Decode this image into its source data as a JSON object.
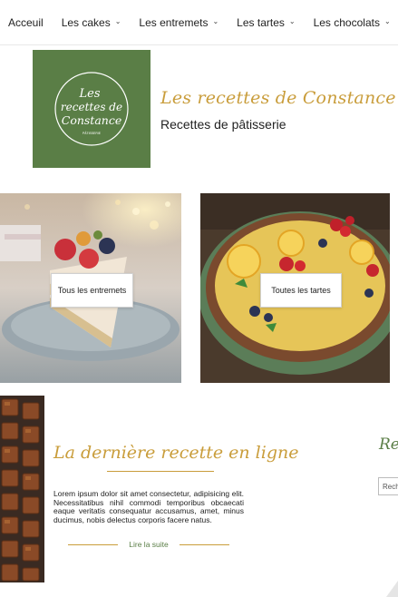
{
  "nav": {
    "items": [
      {
        "label": "Acceuil",
        "has_dropdown": false
      },
      {
        "label": "Les cakes",
        "has_dropdown": true
      },
      {
        "label": "Les entremets",
        "has_dropdown": true
      },
      {
        "label": "Les tartes",
        "has_dropdown": true
      },
      {
        "label": "Les chocolats",
        "has_dropdown": true
      }
    ],
    "dropdown_icon": "chevron-down-icon"
  },
  "header": {
    "logo": {
      "lines": [
        "Les",
        "recettes de",
        "Constance"
      ],
      "tagline": "PÂTISSERIE",
      "background": "#5a7e46"
    },
    "title": "Les recettes de Constance",
    "subtitle": "Recettes de pâtisserie"
  },
  "promos": {
    "entremets_button": "Tous les entremets",
    "tartes_button": "Toutes les tartes"
  },
  "latest": {
    "title": "La dernière recette en ligne",
    "body": "Lorem ipsum dolor sit amet consectetur, adipisicing elit. Necessitatibus nihil commodi temporibus obcaecati eaque veritatis consequatur accusamus, amet, minus ducimus, nobis delectus corporis facere natus.",
    "read_more": "Lire la suite"
  },
  "side": {
    "title_partial": "Rec",
    "search_partial": "Rech"
  },
  "colors": {
    "accent_gold": "#c99d3b",
    "brand_green": "#5a7e46"
  }
}
